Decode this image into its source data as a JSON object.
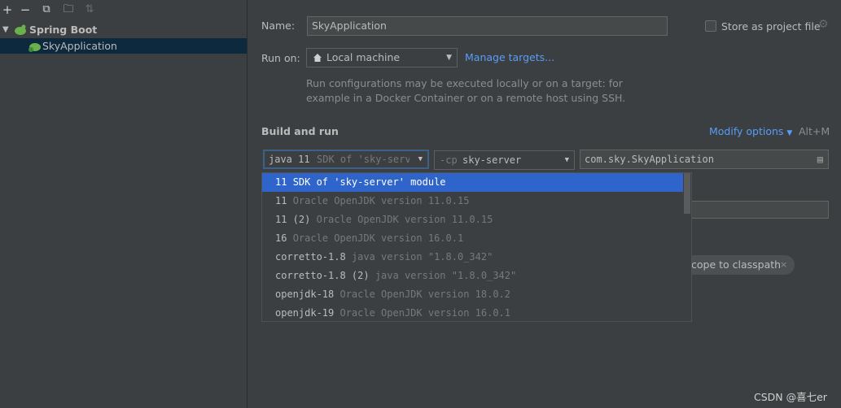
{
  "toolbar": {
    "add": "+",
    "remove": "−",
    "copy": "⧉",
    "folder": "🗀",
    "sort": "⇅"
  },
  "tree": {
    "group_label": "Spring Boot",
    "item_label": "SkyApplication"
  },
  "form": {
    "name_label": "Name:",
    "name_value": "SkyApplication",
    "store_label": "Store as project file",
    "run_on_label": "Run on:",
    "run_on_value": "Local machine",
    "manage_targets": "Manage targets...",
    "hint_line1": "Run configurations may be executed locally or on a target: for",
    "hint_line2": "example in a Docker Container or on a remote host using SSH.",
    "build_run_title": "Build and run",
    "modify_options": "Modify options",
    "modify_shortcut": "Alt+M",
    "jre_name": "java 11",
    "jre_desc": "SDK of 'sky-serve",
    "cp_prefix": "-cp",
    "cp_value": "sky-server",
    "main_class": "com.sky.SkyApplication",
    "chip_text": "cope to classpath",
    "chip_close": "×"
  },
  "dropdown": {
    "options": [
      {
        "name": "11",
        "desc": "SDK of 'sky-server' module",
        "selected": true
      },
      {
        "name": "11",
        "desc": "Oracle OpenJDK version 11.0.15",
        "selected": false
      },
      {
        "name": "11 (2)",
        "desc": "Oracle OpenJDK version 11.0.15",
        "selected": false
      },
      {
        "name": "16",
        "desc": "Oracle OpenJDK version 16.0.1",
        "selected": false
      },
      {
        "name": "corretto-1.8",
        "desc": "java version \"1.8.0_342\"",
        "selected": false
      },
      {
        "name": "corretto-1.8 (2)",
        "desc": "java version \"1.8.0_342\"",
        "selected": false
      },
      {
        "name": "openjdk-18",
        "desc": "Oracle OpenJDK version 18.0.2",
        "selected": false
      },
      {
        "name": "openjdk-19",
        "desc": "Oracle OpenJDK version 16.0.1",
        "selected": false
      }
    ]
  },
  "watermark": "CSDN @喜七er",
  "colors": {
    "background": "#3c3f41",
    "selection": "#2f65ca",
    "tree_selection": "#0d293e",
    "link": "#589df6",
    "spring_green": "#6ab04c"
  }
}
